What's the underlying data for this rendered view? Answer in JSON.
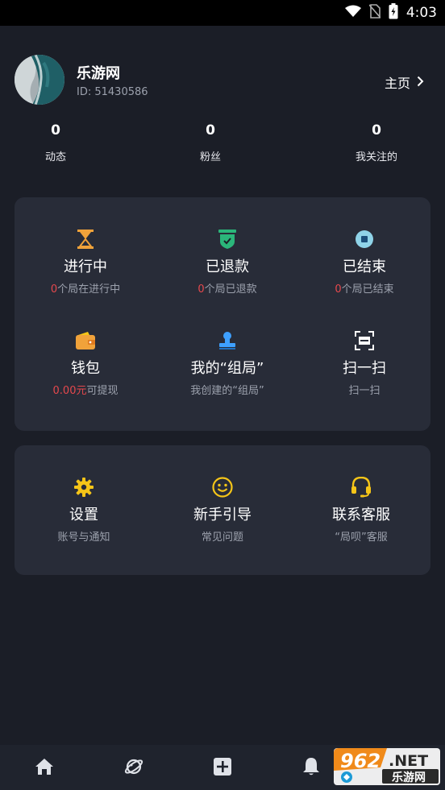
{
  "status_bar": {
    "time": "4:03"
  },
  "profile": {
    "name": "乐游网",
    "id_text": "ID: 51430586",
    "homepage_label": "主页"
  },
  "stats": [
    {
      "value": "0",
      "label": "动态"
    },
    {
      "value": "0",
      "label": "粉丝"
    },
    {
      "value": "0",
      "label": "我关注的"
    }
  ],
  "orders_card": {
    "in_progress": {
      "title": "进行中",
      "count": "0",
      "suffix": "个局在进行中"
    },
    "refunded": {
      "title": "已退款",
      "count": "0",
      "suffix": "个局已退款"
    },
    "ended": {
      "title": "已结束",
      "count": "0",
      "suffix": "个局已结束"
    },
    "wallet": {
      "title": "钱包",
      "amount": "0.00元",
      "suffix": "可提现"
    },
    "my_groups": {
      "title": "我的“组局”",
      "sub": "我创建的“组局”"
    },
    "scan": {
      "title": "扫一扫",
      "sub": "扫一扫"
    }
  },
  "service_card": {
    "settings": {
      "title": "设置",
      "sub": "账号与通知"
    },
    "guide": {
      "title": "新手引导",
      "sub": "常见问题"
    },
    "support": {
      "title": "联系客服",
      "sub": "“局呗”客服"
    }
  },
  "colors": {
    "background": "#1b1e27",
    "card": "#282c38",
    "accent_red": "#e5484d",
    "icon_orange": "#f0a23a",
    "icon_green": "#2bb67a",
    "icon_yellow": "#f5c518"
  },
  "watermark": {
    "top_text": "962",
    "net_text": ".NET",
    "bottom_text": "乐游网"
  }
}
